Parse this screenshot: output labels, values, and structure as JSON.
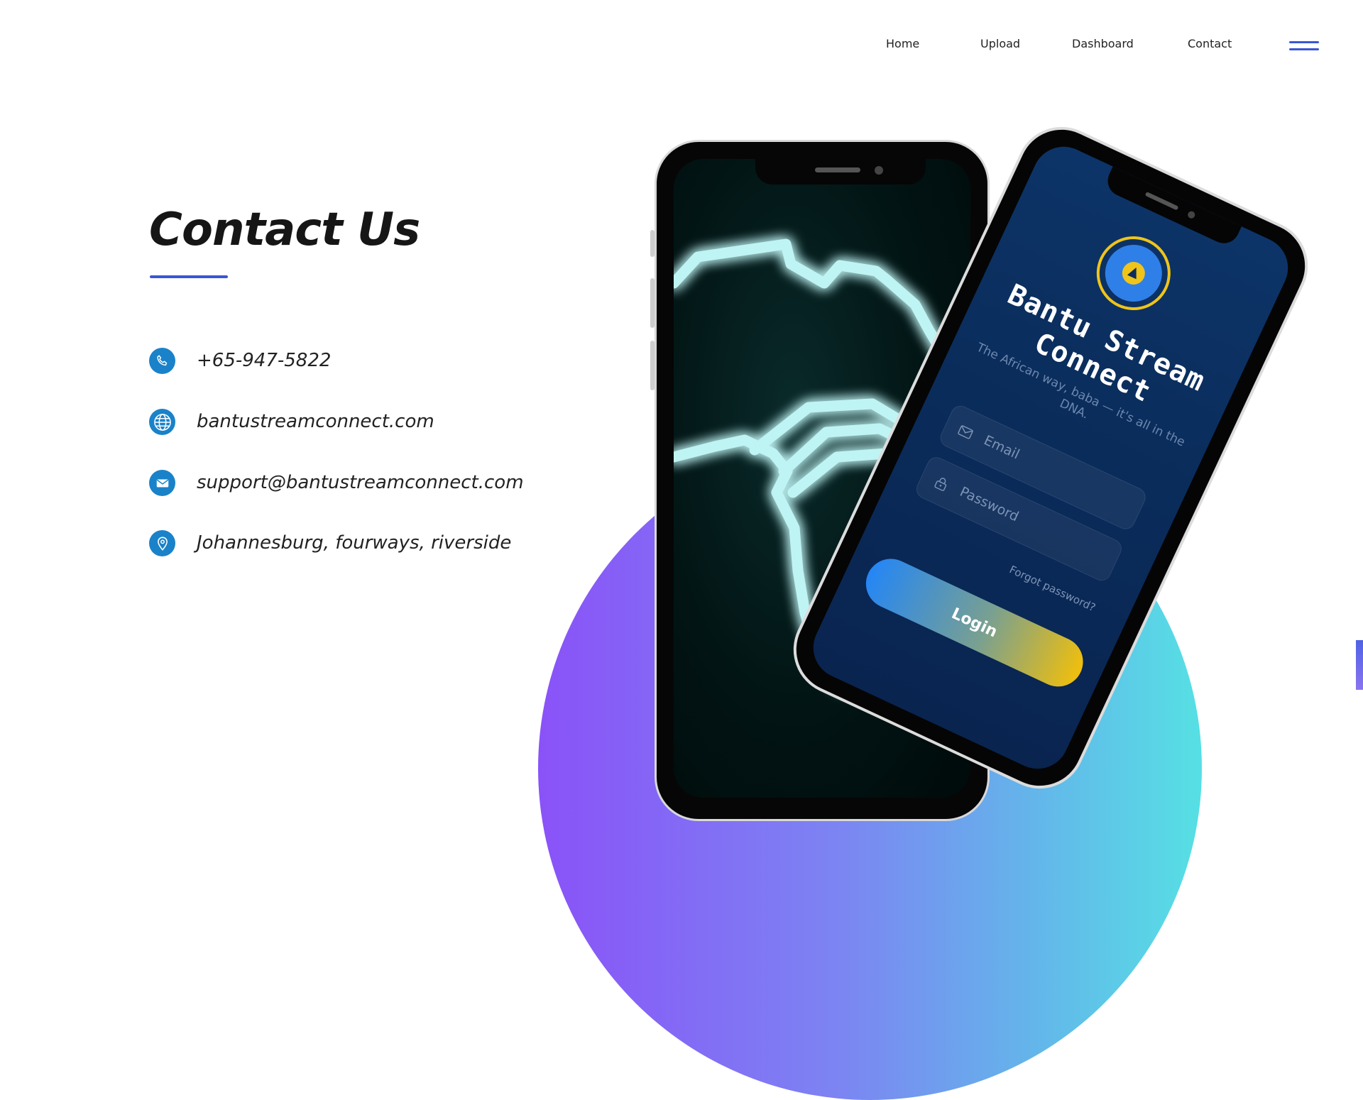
{
  "nav": {
    "items": [
      {
        "label": "Home"
      },
      {
        "label": "Upload"
      },
      {
        "label": "Dashboard"
      },
      {
        "label": "Contact"
      }
    ],
    "menu_icon": "hamburger-menu-icon"
  },
  "contact": {
    "title": "Contact Us",
    "items": [
      {
        "icon": "phone-icon",
        "text": "+65-947-5822"
      },
      {
        "icon": "globe-icon",
        "text": "bantustreamconnect.com"
      },
      {
        "icon": "mail-icon",
        "text": "support@bantustreamconnect.com"
      },
      {
        "icon": "location-pin-icon",
        "text": "Johannesburg, fourways, riverside"
      }
    ]
  },
  "app_preview": {
    "title": "Bantu Stream Connect",
    "tagline": "The African way, baba — it's all in the DNA.",
    "email_placeholder": "Email",
    "password_placeholder": "Password",
    "forgot_link": "Forgot password?",
    "login_label": "Login",
    "africa_map_icon": "africa-map-icon"
  },
  "colors": {
    "accent": "#3a56d4",
    "icon_bg": "#1a82c9",
    "gradient_start": "#8a52f8",
    "gradient_end": "#56e0e4",
    "neon": "#bff4f4",
    "login_gold": "#f0bf0c"
  }
}
